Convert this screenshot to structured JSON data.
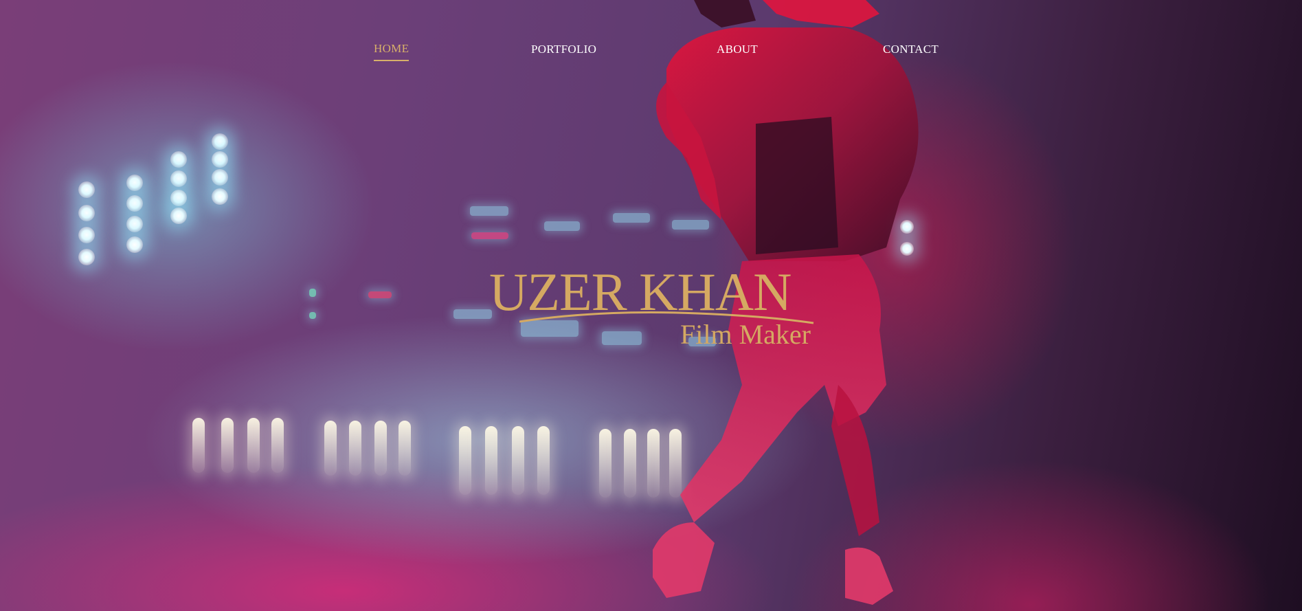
{
  "nav": {
    "items": [
      {
        "label": "HOME",
        "active": true
      },
      {
        "label": "PORTFOLIO",
        "active": false
      },
      {
        "label": "ABOUT",
        "active": false
      },
      {
        "label": "CONTACT",
        "active": false
      }
    ]
  },
  "brand": {
    "name": "UZER KHAN",
    "subtitle": "Film Maker"
  },
  "colors": {
    "accent_gold": "#d5a962",
    "nav_text": "#ffffff"
  }
}
